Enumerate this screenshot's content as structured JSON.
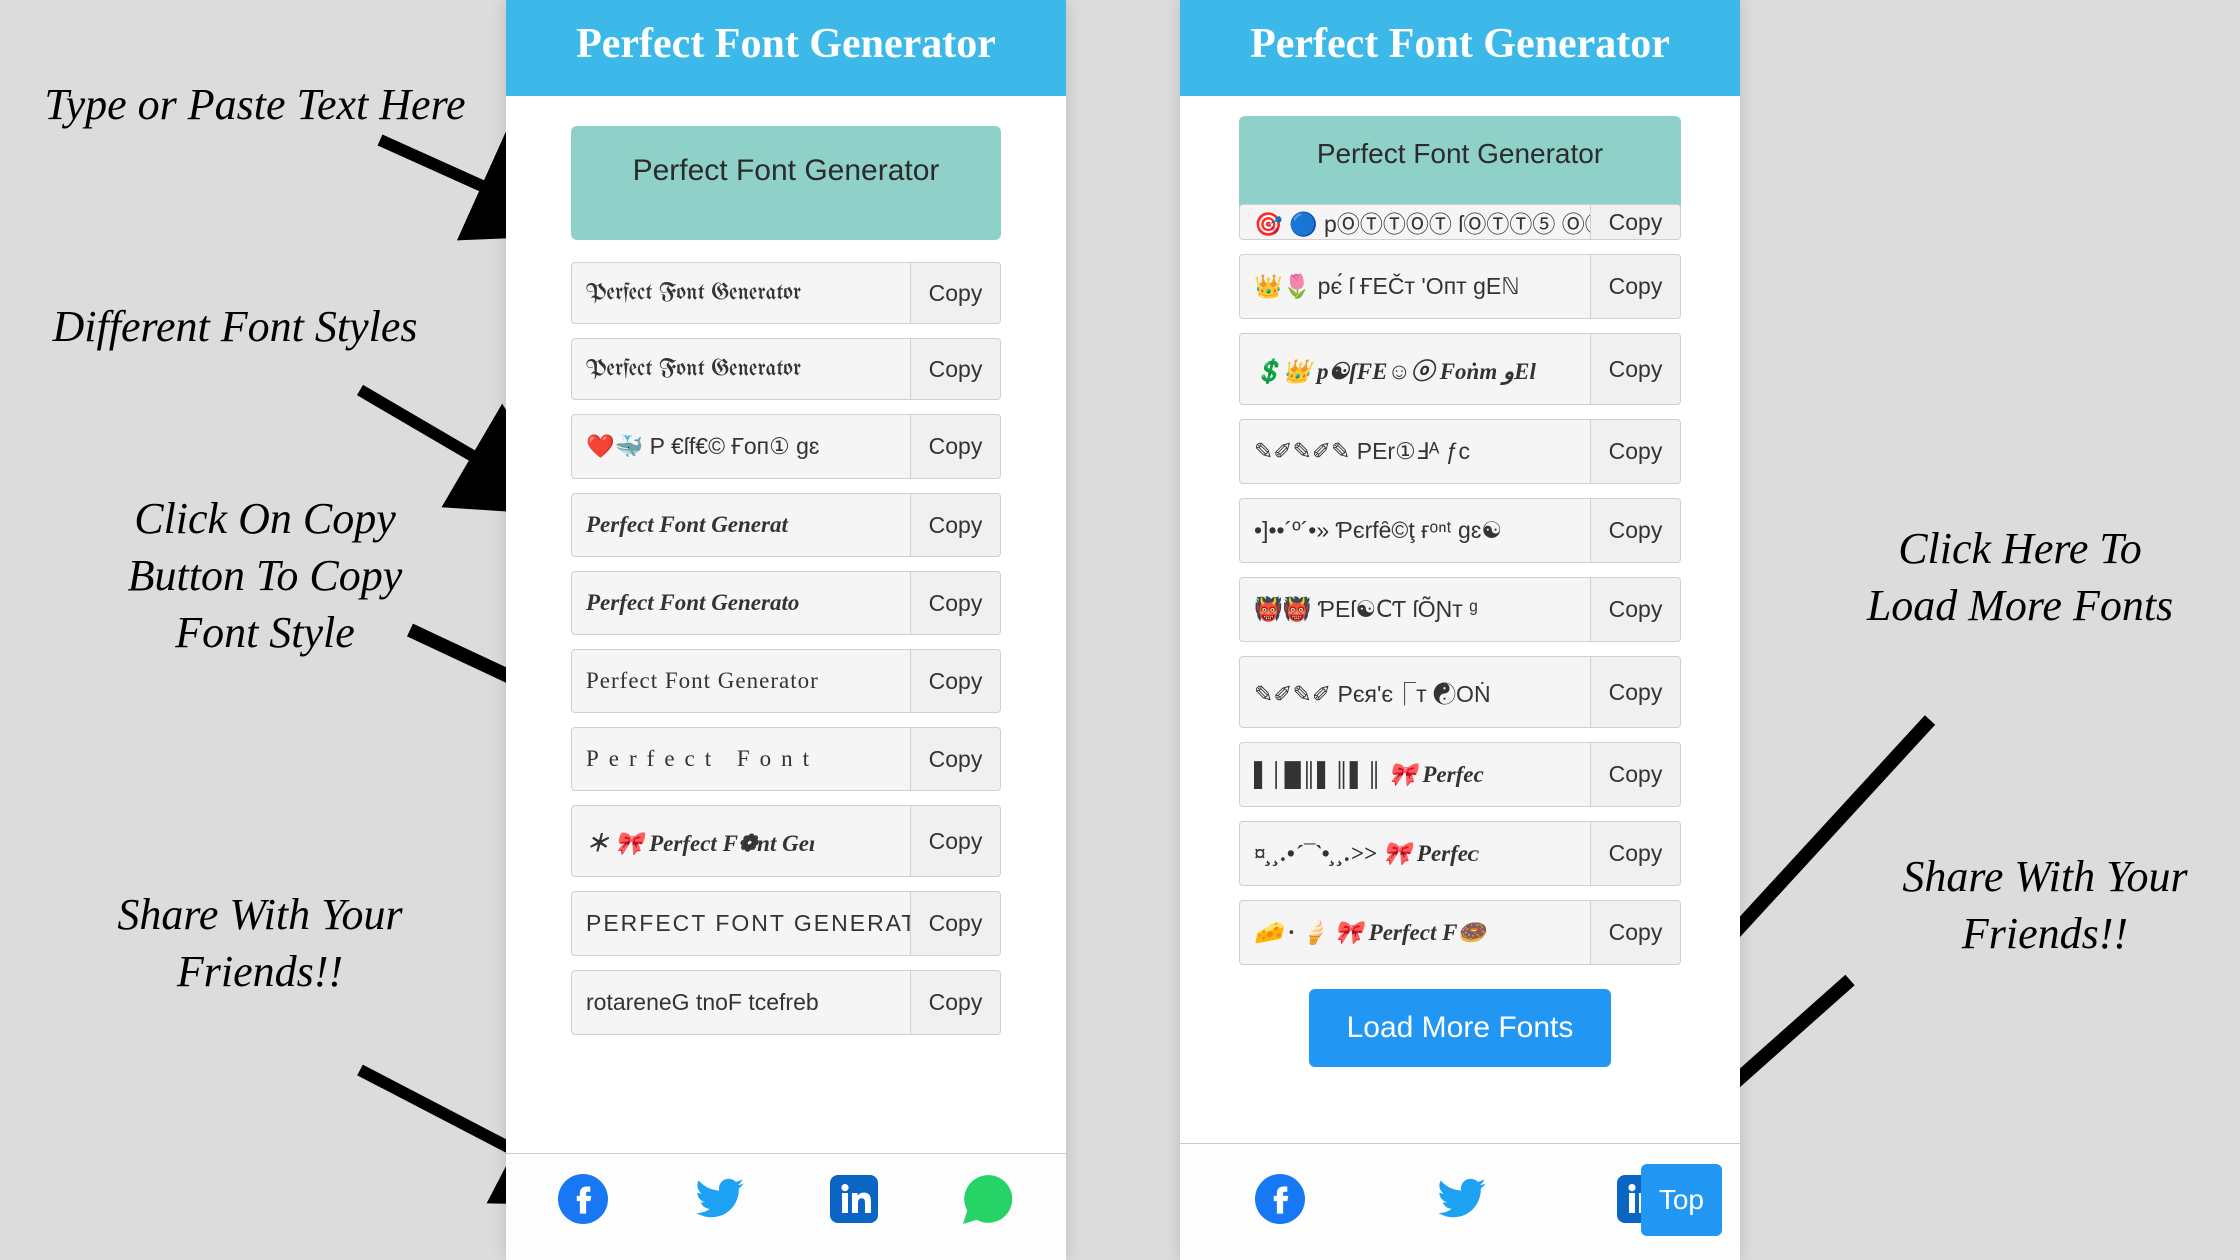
{
  "annotations": {
    "type_paste": "Type or Paste Text Here",
    "different_styles": "Different Font Styles",
    "click_copy": "Click On Copy Button To Copy Font Style",
    "share1": "Share With Your Friends!!",
    "load_more_hint": "Click Here To Load More Fonts",
    "share2": "Share With Your Friends!!"
  },
  "app": {
    "title": "Perfect Font Generator",
    "input_value": "Perfect Font Generator",
    "copy_label": "Copy",
    "load_more_label": "Load More Fonts",
    "top_label": "Top"
  },
  "left_rows": [
    {
      "text": "Perfect Font Generator",
      "style": "fraktur"
    },
    {
      "text": "Perfect Font Generator",
      "style": "fraktur bold"
    },
    {
      "text": "❤️🐳  P €ſf€© Ғoп① gɛ",
      "style": ""
    },
    {
      "text": "Perfect Font Generat",
      "style": "italic"
    },
    {
      "text": "Perfect Font Generato",
      "style": "italic"
    },
    {
      "text": "Perfect Font Generator",
      "style": "outline"
    },
    {
      "text": "Perfect Font",
      "style": "spaced"
    },
    {
      "text": "＊ 🎀  Perfect F❁nt Geı",
      "style": "italic"
    },
    {
      "text": "PERFECT FONT GENERATOR",
      "style": "smallcaps"
    },
    {
      "text": "rotareneG tnoF tcefreb",
      "style": ""
    }
  ],
  "right_rows": [
    {
      "text": "👑🌷  pє́ ſ ҒЕČт 'Oпт gEℕ",
      "style": ""
    },
    {
      "text": "💲👑  p☯ſFE☺ⓞ Foṅт  وEl",
      "style": "italic"
    },
    {
      "text": "✎✐✎✐✎  PEr①Ⅎᴬ ƒc",
      "style": ""
    },
    {
      "text": "•]••´º´•»  Ƥєrfȇ©ţ ғᵒⁿᵗ gɛ☯",
      "style": ""
    },
    {
      "text": "👹👹  ƤЕſ☯ⅭƬ ſÕƝт ᵍ",
      "style": ""
    },
    {
      "text": "✎✐✎✐  Pєя'є⎾т ☯OṄ",
      "style": ""
    },
    {
      "text": "▌│█║▌║▌║  🎀  Perfec",
      "style": "italic"
    },
    {
      "text": "¤¸¸.•´¯`•¸¸.>>  🎀  Perfeᴄ",
      "style": "italic"
    },
    {
      "text": "🧀 · 🍦 🎀  Perfect F🍩",
      "style": "italic"
    }
  ],
  "share_icons": [
    "facebook",
    "twitter",
    "linkedin",
    "whatsapp"
  ]
}
